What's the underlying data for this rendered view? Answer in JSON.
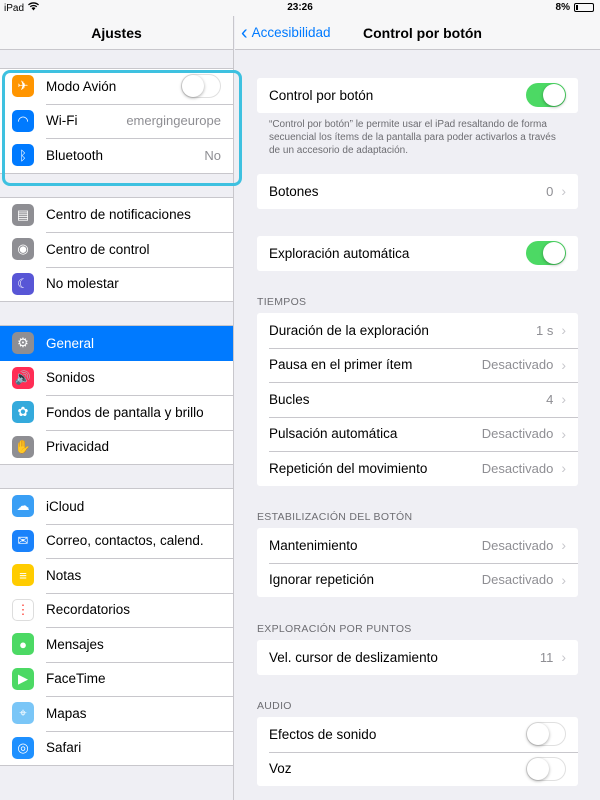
{
  "statusbar": {
    "device": "iPad",
    "time": "23:26",
    "battery": "8%"
  },
  "left": {
    "title": "Ajustes",
    "groups": [
      [
        {
          "label": "Modo Avión",
          "icon": "airplane-icon",
          "color": "#ff9500",
          "toggle": false
        },
        {
          "label": "Wi-Fi",
          "icon": "wifi-icon",
          "color": "#007aff",
          "value": "emergingeurope"
        },
        {
          "label": "Bluetooth",
          "icon": "bluetooth-icon",
          "color": "#007aff",
          "value": "No"
        }
      ],
      [
        {
          "label": "Centro de notificaciones",
          "icon": "notifications-icon",
          "color": "#8e8e93"
        },
        {
          "label": "Centro de control",
          "icon": "control-center-icon",
          "color": "#8e8e93"
        },
        {
          "label": "No molestar",
          "icon": "moon-icon",
          "color": "#5856d6"
        }
      ],
      [
        {
          "label": "General",
          "icon": "gear-icon",
          "color": "#8e8e93",
          "selected": true
        },
        {
          "label": "Sonidos",
          "icon": "speaker-icon",
          "color": "#ff2d55"
        },
        {
          "label": "Fondos de pantalla y brillo",
          "icon": "wallpaper-icon",
          "color": "#34aadc"
        },
        {
          "label": "Privacidad",
          "icon": "hand-icon",
          "color": "#8e8e93"
        }
      ],
      [
        {
          "label": "iCloud",
          "icon": "cloud-icon",
          "color": "#3a9ff5"
        },
        {
          "label": "Correo, contactos, calend.",
          "icon": "mail-icon",
          "color": "#1a82fb"
        },
        {
          "label": "Notas",
          "icon": "notes-icon",
          "color": "#ffcc00"
        },
        {
          "label": "Recordatorios",
          "icon": "reminders-icon",
          "color": "#ffffff"
        },
        {
          "label": "Mensajes",
          "icon": "messages-icon",
          "color": "#4cd964"
        },
        {
          "label": "FaceTime",
          "icon": "facetime-icon",
          "color": "#4cd964"
        },
        {
          "label": "Mapas",
          "icon": "maps-icon",
          "color": "#7ac6f7"
        },
        {
          "label": "Safari",
          "icon": "safari-icon",
          "color": "#1e90ff"
        }
      ]
    ]
  },
  "right": {
    "back_label": "Accesibilidad",
    "title": "Control por botón",
    "main_toggle_label": "Control por botón",
    "main_toggle": true,
    "footer": "“Control por botón” le permite usar el iPad resaltando de forma secuencial los ítems de la pantalla para poder activarlos a través de un accesorio de adaptación.",
    "botones": {
      "label": "Botones",
      "value": "0"
    },
    "auto_scan": {
      "label": "Exploración automática",
      "toggle": true
    },
    "tiempos": {
      "header": "TIEMPOS",
      "rows": [
        {
          "label": "Duración de la exploración",
          "value": "1 s"
        },
        {
          "label": "Pausa en el primer ítem",
          "value": "Desactivado"
        },
        {
          "label": "Bucles",
          "value": "4"
        },
        {
          "label": "Pulsación automática",
          "value": "Desactivado"
        },
        {
          "label": "Repetición del movimiento",
          "value": "Desactivado"
        }
      ]
    },
    "estabilizacion": {
      "header": "ESTABILIZACIÓN DEL BOTÓN",
      "rows": [
        {
          "label": "Mantenimiento",
          "value": "Desactivado"
        },
        {
          "label": "Ignorar repetición",
          "value": "Desactivado"
        }
      ]
    },
    "puntos": {
      "header": "EXPLORACIÓN POR PUNTOS",
      "rows": [
        {
          "label": "Vel. cursor de deslizamiento",
          "value": "11"
        }
      ]
    },
    "audio": {
      "header": "AUDIO",
      "rows": [
        {
          "label": "Efectos de sonido",
          "toggle": false
        },
        {
          "label": "Voz",
          "toggle": false
        }
      ]
    }
  }
}
